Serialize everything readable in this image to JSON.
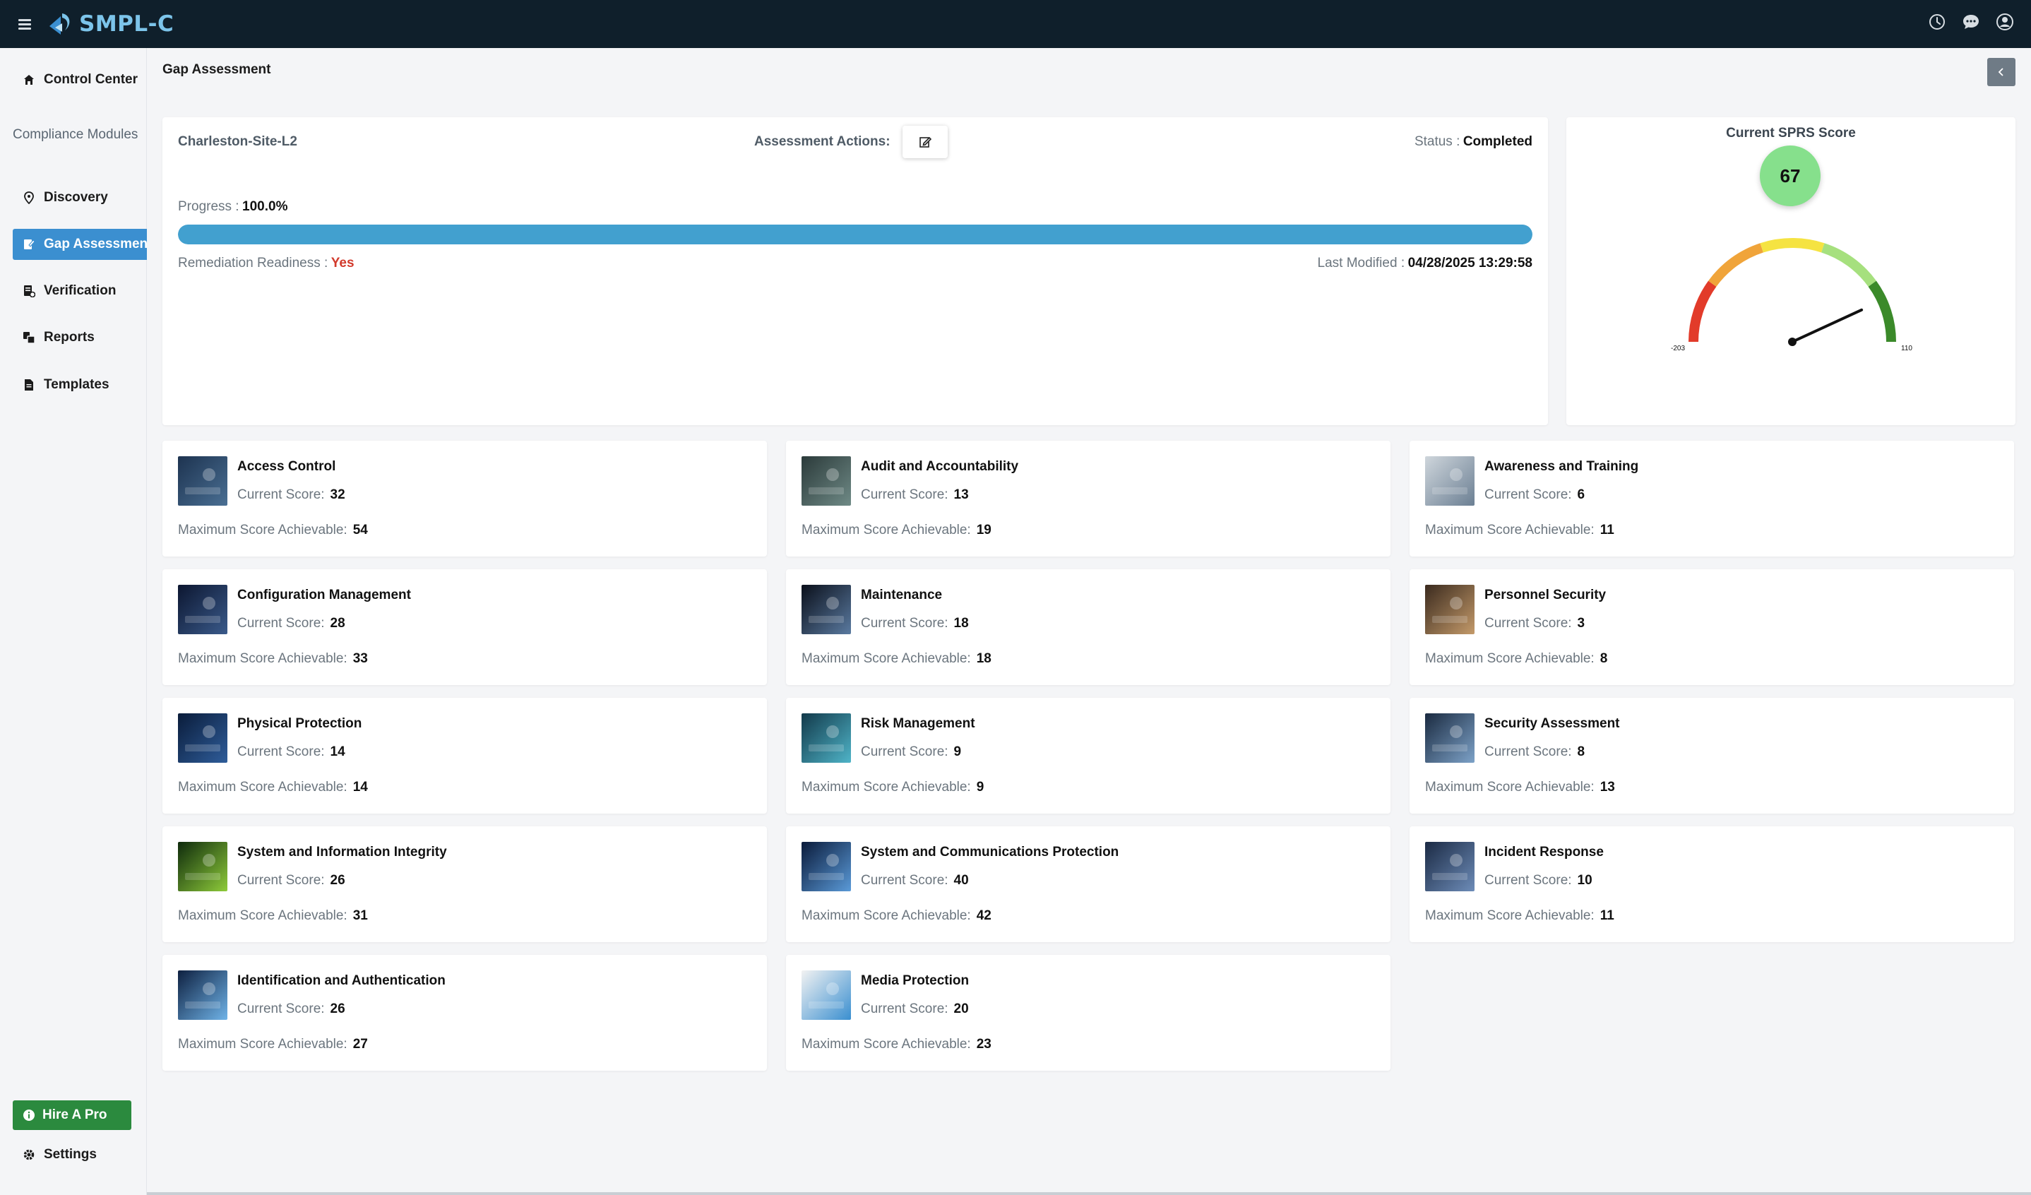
{
  "app": {
    "logo_text": "SMPL-C"
  },
  "sidebar": {
    "control_center": "Control Center",
    "section_label": "Compliance Modules",
    "items": [
      {
        "label": "Discovery"
      },
      {
        "label": "Gap Assessment"
      },
      {
        "label": "Verification"
      },
      {
        "label": "Reports"
      },
      {
        "label": "Templates"
      }
    ],
    "hire_label": "Hire A Pro",
    "settings_label": "Settings"
  },
  "page": {
    "title": "Gap Assessment"
  },
  "assessment": {
    "site": "Charleston-Site-L2",
    "actions_label": "Assessment Actions:",
    "status_label": "Status :",
    "status_value": "Completed",
    "progress_label": "Progress :",
    "progress_value": "100.0%",
    "progress_fraction": 1.0,
    "readiness_label": "Remediation Readiness :",
    "readiness_value": "Yes",
    "modified_label": "Last Modified :",
    "modified_value": "04/28/2025 13:29:58"
  },
  "sprs": {
    "title": "Current SPRS Score",
    "score": "67",
    "min_label": "-203",
    "max_label": "110",
    "min": -203,
    "max": 110,
    "value": 67,
    "colors": [
      "#e23b2a",
      "#f0a43a",
      "#f5e342",
      "#a6e07e",
      "#3b8a2a"
    ]
  },
  "labels": {
    "current": "Current Score:",
    "max": "Maximum Score Achievable:"
  },
  "categories": [
    {
      "name": "Access Control",
      "current": "32",
      "max": "54",
      "img": [
        "#1d3350",
        "#4a6f93"
      ]
    },
    {
      "name": "Audit and Accountability",
      "current": "13",
      "max": "19",
      "img": [
        "#2b3a3a",
        "#6f8a86"
      ]
    },
    {
      "name": "Awareness and Training",
      "current": "6",
      "max": "11",
      "img": [
        "#cfd6dc",
        "#6b7f93"
      ]
    },
    {
      "name": "Configuration Management",
      "current": "28",
      "max": "33",
      "img": [
        "#0c1630",
        "#3a5a8a"
      ]
    },
    {
      "name": "Maintenance",
      "current": "18",
      "max": "18",
      "img": [
        "#0a0f1a",
        "#5a7aa0"
      ]
    },
    {
      "name": "Personnel Security",
      "current": "3",
      "max": "8",
      "img": [
        "#3a2a1e",
        "#c49a6a"
      ]
    },
    {
      "name": "Physical Protection",
      "current": "14",
      "max": "14",
      "img": [
        "#0a1c3a",
        "#2f5d9a"
      ]
    },
    {
      "name": "Risk Management",
      "current": "9",
      "max": "9",
      "img": [
        "#12394a",
        "#4fb4c8"
      ]
    },
    {
      "name": "Security Assessment",
      "current": "8",
      "max": "13",
      "img": [
        "#1a2a40",
        "#7da2c8"
      ]
    },
    {
      "name": "System and Information Integrity",
      "current": "26",
      "max": "31",
      "img": [
        "#0e2a0c",
        "#8ecb3a"
      ]
    },
    {
      "name": "System and Communications Protection",
      "current": "40",
      "max": "42",
      "img": [
        "#0a1a3a",
        "#5a9ad8"
      ]
    },
    {
      "name": "Incident Response",
      "current": "10",
      "max": "11",
      "img": [
        "#1b2a44",
        "#6d8cb8"
      ]
    },
    {
      "name": "Identification and Authentication",
      "current": "26",
      "max": "27",
      "img": [
        "#0e2040",
        "#6fb3e8"
      ]
    },
    {
      "name": "Media Protection",
      "current": "20",
      "max": "23",
      "img": [
        "#f2f2f2",
        "#3a8fd0"
      ]
    }
  ]
}
